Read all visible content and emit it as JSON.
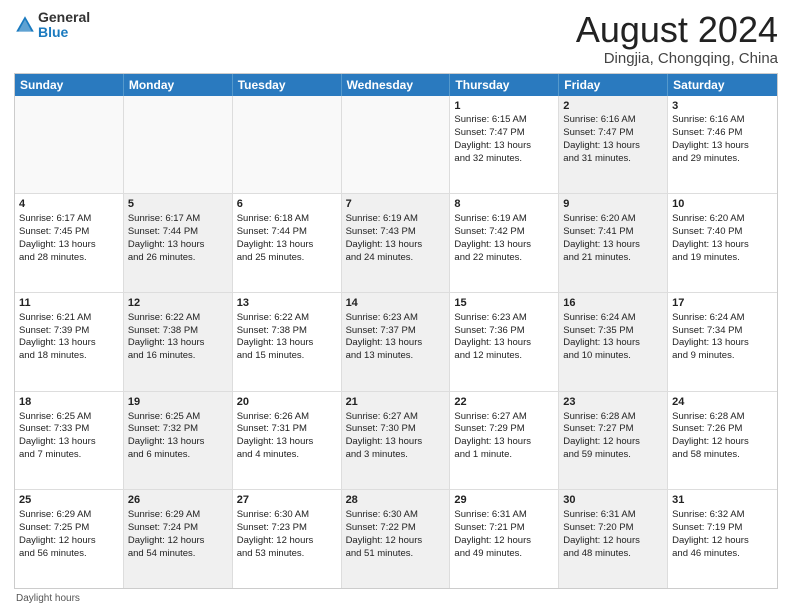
{
  "header": {
    "logo": {
      "general": "General",
      "blue": "Blue"
    },
    "title": "August 2024",
    "location": "Dingjia, Chongqing, China"
  },
  "calendar": {
    "days": [
      "Sunday",
      "Monday",
      "Tuesday",
      "Wednesday",
      "Thursday",
      "Friday",
      "Saturday"
    ],
    "rows": [
      [
        {
          "day": "",
          "content": "",
          "empty": true
        },
        {
          "day": "",
          "content": "",
          "empty": true
        },
        {
          "day": "",
          "content": "",
          "empty": true
        },
        {
          "day": "",
          "content": "",
          "empty": true
        },
        {
          "day": "1",
          "content": "Sunrise: 6:15 AM\nSunset: 7:47 PM\nDaylight: 13 hours\nand 32 minutes.",
          "empty": false,
          "shaded": false
        },
        {
          "day": "2",
          "content": "Sunrise: 6:16 AM\nSunset: 7:47 PM\nDaylight: 13 hours\nand 31 minutes.",
          "empty": false,
          "shaded": true
        },
        {
          "day": "3",
          "content": "Sunrise: 6:16 AM\nSunset: 7:46 PM\nDaylight: 13 hours\nand 29 minutes.",
          "empty": false,
          "shaded": false
        }
      ],
      [
        {
          "day": "4",
          "content": "Sunrise: 6:17 AM\nSunset: 7:45 PM\nDaylight: 13 hours\nand 28 minutes.",
          "empty": false,
          "shaded": false
        },
        {
          "day": "5",
          "content": "Sunrise: 6:17 AM\nSunset: 7:44 PM\nDaylight: 13 hours\nand 26 minutes.",
          "empty": false,
          "shaded": true
        },
        {
          "day": "6",
          "content": "Sunrise: 6:18 AM\nSunset: 7:44 PM\nDaylight: 13 hours\nand 25 minutes.",
          "empty": false,
          "shaded": false
        },
        {
          "day": "7",
          "content": "Sunrise: 6:19 AM\nSunset: 7:43 PM\nDaylight: 13 hours\nand 24 minutes.",
          "empty": false,
          "shaded": true
        },
        {
          "day": "8",
          "content": "Sunrise: 6:19 AM\nSunset: 7:42 PM\nDaylight: 13 hours\nand 22 minutes.",
          "empty": false,
          "shaded": false
        },
        {
          "day": "9",
          "content": "Sunrise: 6:20 AM\nSunset: 7:41 PM\nDaylight: 13 hours\nand 21 minutes.",
          "empty": false,
          "shaded": true
        },
        {
          "day": "10",
          "content": "Sunrise: 6:20 AM\nSunset: 7:40 PM\nDaylight: 13 hours\nand 19 minutes.",
          "empty": false,
          "shaded": false
        }
      ],
      [
        {
          "day": "11",
          "content": "Sunrise: 6:21 AM\nSunset: 7:39 PM\nDaylight: 13 hours\nand 18 minutes.",
          "empty": false,
          "shaded": false
        },
        {
          "day": "12",
          "content": "Sunrise: 6:22 AM\nSunset: 7:38 PM\nDaylight: 13 hours\nand 16 minutes.",
          "empty": false,
          "shaded": true
        },
        {
          "day": "13",
          "content": "Sunrise: 6:22 AM\nSunset: 7:38 PM\nDaylight: 13 hours\nand 15 minutes.",
          "empty": false,
          "shaded": false
        },
        {
          "day": "14",
          "content": "Sunrise: 6:23 AM\nSunset: 7:37 PM\nDaylight: 13 hours\nand 13 minutes.",
          "empty": false,
          "shaded": true
        },
        {
          "day": "15",
          "content": "Sunrise: 6:23 AM\nSunset: 7:36 PM\nDaylight: 13 hours\nand 12 minutes.",
          "empty": false,
          "shaded": false
        },
        {
          "day": "16",
          "content": "Sunrise: 6:24 AM\nSunset: 7:35 PM\nDaylight: 13 hours\nand 10 minutes.",
          "empty": false,
          "shaded": true
        },
        {
          "day": "17",
          "content": "Sunrise: 6:24 AM\nSunset: 7:34 PM\nDaylight: 13 hours\nand 9 minutes.",
          "empty": false,
          "shaded": false
        }
      ],
      [
        {
          "day": "18",
          "content": "Sunrise: 6:25 AM\nSunset: 7:33 PM\nDaylight: 13 hours\nand 7 minutes.",
          "empty": false,
          "shaded": false
        },
        {
          "day": "19",
          "content": "Sunrise: 6:25 AM\nSunset: 7:32 PM\nDaylight: 13 hours\nand 6 minutes.",
          "empty": false,
          "shaded": true
        },
        {
          "day": "20",
          "content": "Sunrise: 6:26 AM\nSunset: 7:31 PM\nDaylight: 13 hours\nand 4 minutes.",
          "empty": false,
          "shaded": false
        },
        {
          "day": "21",
          "content": "Sunrise: 6:27 AM\nSunset: 7:30 PM\nDaylight: 13 hours\nand 3 minutes.",
          "empty": false,
          "shaded": true
        },
        {
          "day": "22",
          "content": "Sunrise: 6:27 AM\nSunset: 7:29 PM\nDaylight: 13 hours\nand 1 minute.",
          "empty": false,
          "shaded": false
        },
        {
          "day": "23",
          "content": "Sunrise: 6:28 AM\nSunset: 7:27 PM\nDaylight: 12 hours\nand 59 minutes.",
          "empty": false,
          "shaded": true
        },
        {
          "day": "24",
          "content": "Sunrise: 6:28 AM\nSunset: 7:26 PM\nDaylight: 12 hours\nand 58 minutes.",
          "empty": false,
          "shaded": false
        }
      ],
      [
        {
          "day": "25",
          "content": "Sunrise: 6:29 AM\nSunset: 7:25 PM\nDaylight: 12 hours\nand 56 minutes.",
          "empty": false,
          "shaded": false
        },
        {
          "day": "26",
          "content": "Sunrise: 6:29 AM\nSunset: 7:24 PM\nDaylight: 12 hours\nand 54 minutes.",
          "empty": false,
          "shaded": true
        },
        {
          "day": "27",
          "content": "Sunrise: 6:30 AM\nSunset: 7:23 PM\nDaylight: 12 hours\nand 53 minutes.",
          "empty": false,
          "shaded": false
        },
        {
          "day": "28",
          "content": "Sunrise: 6:30 AM\nSunset: 7:22 PM\nDaylight: 12 hours\nand 51 minutes.",
          "empty": false,
          "shaded": true
        },
        {
          "day": "29",
          "content": "Sunrise: 6:31 AM\nSunset: 7:21 PM\nDaylight: 12 hours\nand 49 minutes.",
          "empty": false,
          "shaded": false
        },
        {
          "day": "30",
          "content": "Sunrise: 6:31 AM\nSunset: 7:20 PM\nDaylight: 12 hours\nand 48 minutes.",
          "empty": false,
          "shaded": true
        },
        {
          "day": "31",
          "content": "Sunrise: 6:32 AM\nSunset: 7:19 PM\nDaylight: 12 hours\nand 46 minutes.",
          "empty": false,
          "shaded": false
        }
      ]
    ],
    "footer": "Daylight hours"
  }
}
